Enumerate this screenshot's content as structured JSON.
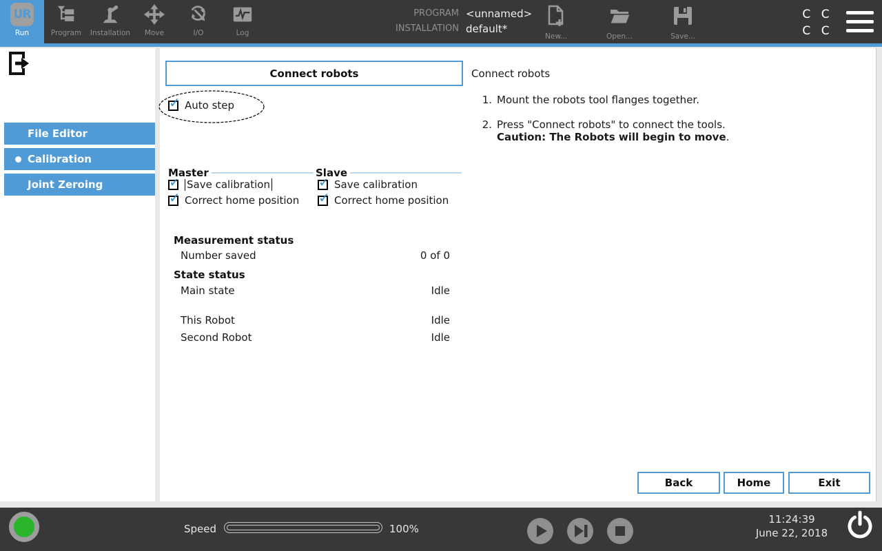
{
  "header": {
    "tabs": [
      {
        "label": "Run",
        "active": true
      },
      {
        "label": "Program"
      },
      {
        "label": "Installation"
      },
      {
        "label": "Move"
      },
      {
        "label": "I/O"
      },
      {
        "label": "Log"
      }
    ],
    "ur_logo_text": "UR",
    "program_label": "PROGRAM",
    "program_value": "<unnamed>",
    "installation_label": "INSTALLATION",
    "installation_value": "default*",
    "new_label": "New...",
    "open_label": "Open...",
    "save_label": "Save...",
    "corner_row1": "C C",
    "corner_row2": "C C"
  },
  "sidebar": {
    "items": [
      {
        "label": "File Editor"
      },
      {
        "label": "Calibration",
        "active": true
      },
      {
        "label": "Joint Zeroing"
      }
    ]
  },
  "main": {
    "connect_button_label": "Connect robots",
    "auto_step_label": "Auto step",
    "master": {
      "title": "Master",
      "save_label": "Save calibration",
      "home_label": "Correct home position"
    },
    "slave": {
      "title": "Slave",
      "save_label": "Save calibration",
      "home_label": "Correct home position"
    },
    "measurement": {
      "title": "Measurement status",
      "number_saved_label": "Number saved",
      "number_saved_value": "0 of 0"
    },
    "state": {
      "title": "State status",
      "rows": [
        {
          "label": "Main state",
          "value": "Idle"
        },
        {
          "label": "This Robot",
          "value": "Idle"
        },
        {
          "label": "Second Robot",
          "value": "Idle"
        }
      ]
    },
    "instructions": {
      "title": "Connect robots",
      "step1_num": "1.",
      "step1": "Mount the robots tool flanges together.",
      "step2_num": "2.",
      "step2": "Press \"Connect robots\" to connect the tools.",
      "caution": "Caution: The Robots will begin to move",
      "caution_suffix": "."
    },
    "back_label": "Back",
    "home_label": "Home",
    "exit_label": "Exit"
  },
  "footer": {
    "speed_label": "Speed",
    "speed_value": "100%",
    "time": "11:24:39",
    "date": "June 22, 2018"
  },
  "colors": {
    "accent_blue": "#509bd5",
    "header_bg": "#383838",
    "icon_gray": "#9a9a9a",
    "status_green": "#2ab52a",
    "check_blue": "#3392d2",
    "group_line_blue": "#bcd6ea"
  }
}
